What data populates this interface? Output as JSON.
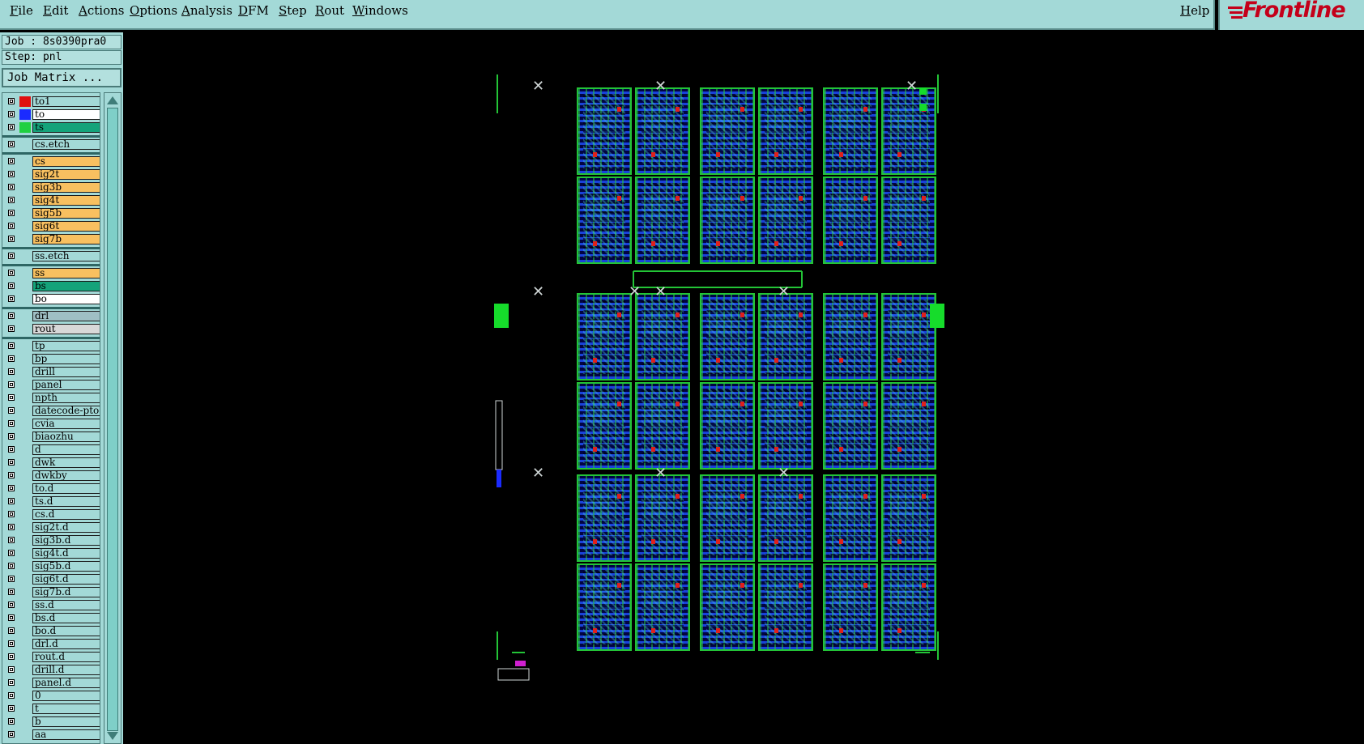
{
  "menu": {
    "items": [
      "File",
      "Edit",
      "Actions",
      "Options",
      "Analysis",
      "DFM",
      "Step",
      "Rout",
      "Windows"
    ],
    "help": "Help"
  },
  "logo": {
    "text": "Frontline"
  },
  "panel": {
    "job": "Job : 8s0390pra0",
    "step": "Step: pnl",
    "job_matrix": "Job Matrix ..."
  },
  "layers": [
    {
      "name": "to1",
      "bg": "#a3d9d7",
      "swatch": "#e01010",
      "group": 0
    },
    {
      "name": "to",
      "bg": "#ffffff",
      "swatch": "#1b2bff",
      "group": 0
    },
    {
      "name": "ts",
      "bg": "#14a37a",
      "swatch": "#20d040",
      "group": 0
    },
    {
      "name": "cs.etch",
      "bg": "#a3d9d7",
      "swatch": "",
      "group": 1
    },
    {
      "name": "cs",
      "bg": "#f8c060",
      "swatch": "",
      "group": 2
    },
    {
      "name": "sig2t",
      "bg": "#f8c060",
      "swatch": "",
      "group": 2
    },
    {
      "name": "sig3b",
      "bg": "#f8c060",
      "swatch": "",
      "group": 2
    },
    {
      "name": "sig4t",
      "bg": "#f8c060",
      "swatch": "",
      "group": 2
    },
    {
      "name": "sig5b",
      "bg": "#f8c060",
      "swatch": "",
      "group": 2
    },
    {
      "name": "sig6t",
      "bg": "#f8c060",
      "swatch": "",
      "group": 2
    },
    {
      "name": "sig7b",
      "bg": "#f8c060",
      "swatch": "",
      "group": 2
    },
    {
      "name": "ss.etch",
      "bg": "#a3d9d7",
      "swatch": "",
      "group": 3
    },
    {
      "name": "ss",
      "bg": "#f8c060",
      "swatch": "",
      "group": 4
    },
    {
      "name": "bs",
      "bg": "#14a37a",
      "swatch": "",
      "group": 4
    },
    {
      "name": "bo",
      "bg": "#ffffff",
      "swatch": "",
      "group": 4
    },
    {
      "name": "drl",
      "bg": "#9fbfc4",
      "swatch": "",
      "group": 5
    },
    {
      "name": "rout",
      "bg": "#d8d8d8",
      "swatch": "",
      "group": 5
    },
    {
      "name": "tp",
      "bg": "#a3d9d7",
      "swatch": "",
      "group": 6
    },
    {
      "name": "bp",
      "bg": "#a3d9d7",
      "swatch": "",
      "group": 6
    },
    {
      "name": "drill",
      "bg": "#a3d9d7",
      "swatch": "",
      "group": 6
    },
    {
      "name": "panel",
      "bg": "#a3d9d7",
      "swatch": "",
      "group": 6
    },
    {
      "name": "npth",
      "bg": "#a3d9d7",
      "swatch": "",
      "group": 6
    },
    {
      "name": "datecode-pto",
      "bg": "#a3d9d7",
      "swatch": "",
      "group": 6
    },
    {
      "name": "cvia",
      "bg": "#a3d9d7",
      "swatch": "",
      "group": 6
    },
    {
      "name": "biaozhu",
      "bg": "#a3d9d7",
      "swatch": "",
      "group": 6
    },
    {
      "name": "d",
      "bg": "#a3d9d7",
      "swatch": "",
      "group": 6
    },
    {
      "name": "dwk",
      "bg": "#a3d9d7",
      "swatch": "",
      "group": 6
    },
    {
      "name": "dwkby",
      "bg": "#a3d9d7",
      "swatch": "",
      "group": 6
    },
    {
      "name": "to.d",
      "bg": "#a3d9d7",
      "swatch": "",
      "group": 6
    },
    {
      "name": "ts.d",
      "bg": "#a3d9d7",
      "swatch": "",
      "group": 6
    },
    {
      "name": "cs.d",
      "bg": "#a3d9d7",
      "swatch": "",
      "group": 6
    },
    {
      "name": "sig2t.d",
      "bg": "#a3d9d7",
      "swatch": "",
      "group": 6
    },
    {
      "name": "sig3b.d",
      "bg": "#a3d9d7",
      "swatch": "",
      "group": 6
    },
    {
      "name": "sig4t.d",
      "bg": "#a3d9d7",
      "swatch": "",
      "group": 6
    },
    {
      "name": "sig5b.d",
      "bg": "#a3d9d7",
      "swatch": "",
      "group": 6
    },
    {
      "name": "sig6t.d",
      "bg": "#a3d9d7",
      "swatch": "",
      "group": 6
    },
    {
      "name": "sig7b.d",
      "bg": "#a3d9d7",
      "swatch": "",
      "group": 6
    },
    {
      "name": "ss.d",
      "bg": "#a3d9d7",
      "swatch": "",
      "group": 6
    },
    {
      "name": "bs.d",
      "bg": "#a3d9d7",
      "swatch": "",
      "group": 6
    },
    {
      "name": "bo.d",
      "bg": "#a3d9d7",
      "swatch": "",
      "group": 6
    },
    {
      "name": "drl.d",
      "bg": "#a3d9d7",
      "swatch": "",
      "group": 6
    },
    {
      "name": "rout.d",
      "bg": "#a3d9d7",
      "swatch": "",
      "group": 6
    },
    {
      "name": "drill.d",
      "bg": "#a3d9d7",
      "swatch": "",
      "group": 6
    },
    {
      "name": "panel.d",
      "bg": "#a3d9d7",
      "swatch": "",
      "group": 6
    },
    {
      "name": "0",
      "bg": "#a3d9d7",
      "swatch": "",
      "group": 6
    },
    {
      "name": "t",
      "bg": "#a3d9d7",
      "swatch": "",
      "group": 6
    },
    {
      "name": "b",
      "bg": "#a3d9d7",
      "swatch": "",
      "group": 6
    },
    {
      "name": "aa",
      "bg": "#a3d9d7",
      "swatch": "",
      "group": 6
    }
  ],
  "colors": {
    "ui_bg": "#a3d9d7",
    "canvas_bg": "#000000",
    "board_outline": "#23c437",
    "copper_blue": "#1b2bff"
  },
  "icons": {
    "panel_toggle": "square-checkbox-icon",
    "logo_mark": "frontline-stripes-icon"
  }
}
